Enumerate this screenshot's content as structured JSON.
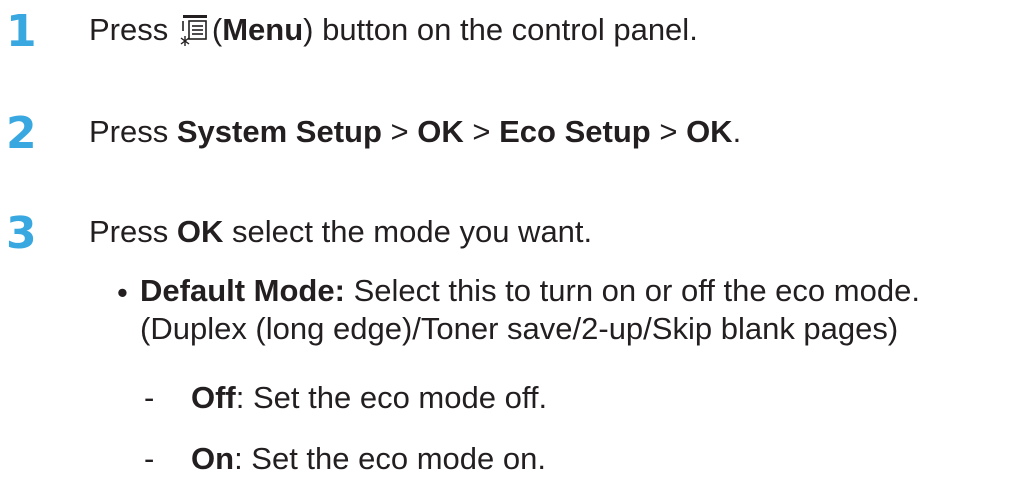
{
  "steps": [
    {
      "number": "1",
      "before_icon": "Press",
      "icon": "menu-icon",
      "open_paren": "(",
      "bold": "Menu",
      "after": ") button on the control panel."
    },
    {
      "number": "2",
      "press": "Press",
      "item1": "System Setup",
      "sep1": ">",
      "item2": "OK",
      "sep2": ">",
      "item3": "Eco Setup",
      "sep3": ">",
      "item4": "OK",
      "end": "."
    },
    {
      "number": "3",
      "press": "Press",
      "bold": "OK",
      "after": "select the mode you want."
    }
  ],
  "bullet": {
    "marker": "•",
    "title": "Default Mode:",
    "text": "Select this to turn on or off the eco mode.",
    "line2": "(Duplex (long edge)/Toner save/2-up/Skip blank pages)"
  },
  "options": [
    {
      "marker": "-",
      "label": "Off",
      "text": ": Set the eco mode off."
    },
    {
      "marker": "-",
      "label": "On",
      "text": ": Set the eco mode on."
    }
  ],
  "colors": {
    "step_number": "#3aa8e0",
    "text": "#231f20"
  }
}
